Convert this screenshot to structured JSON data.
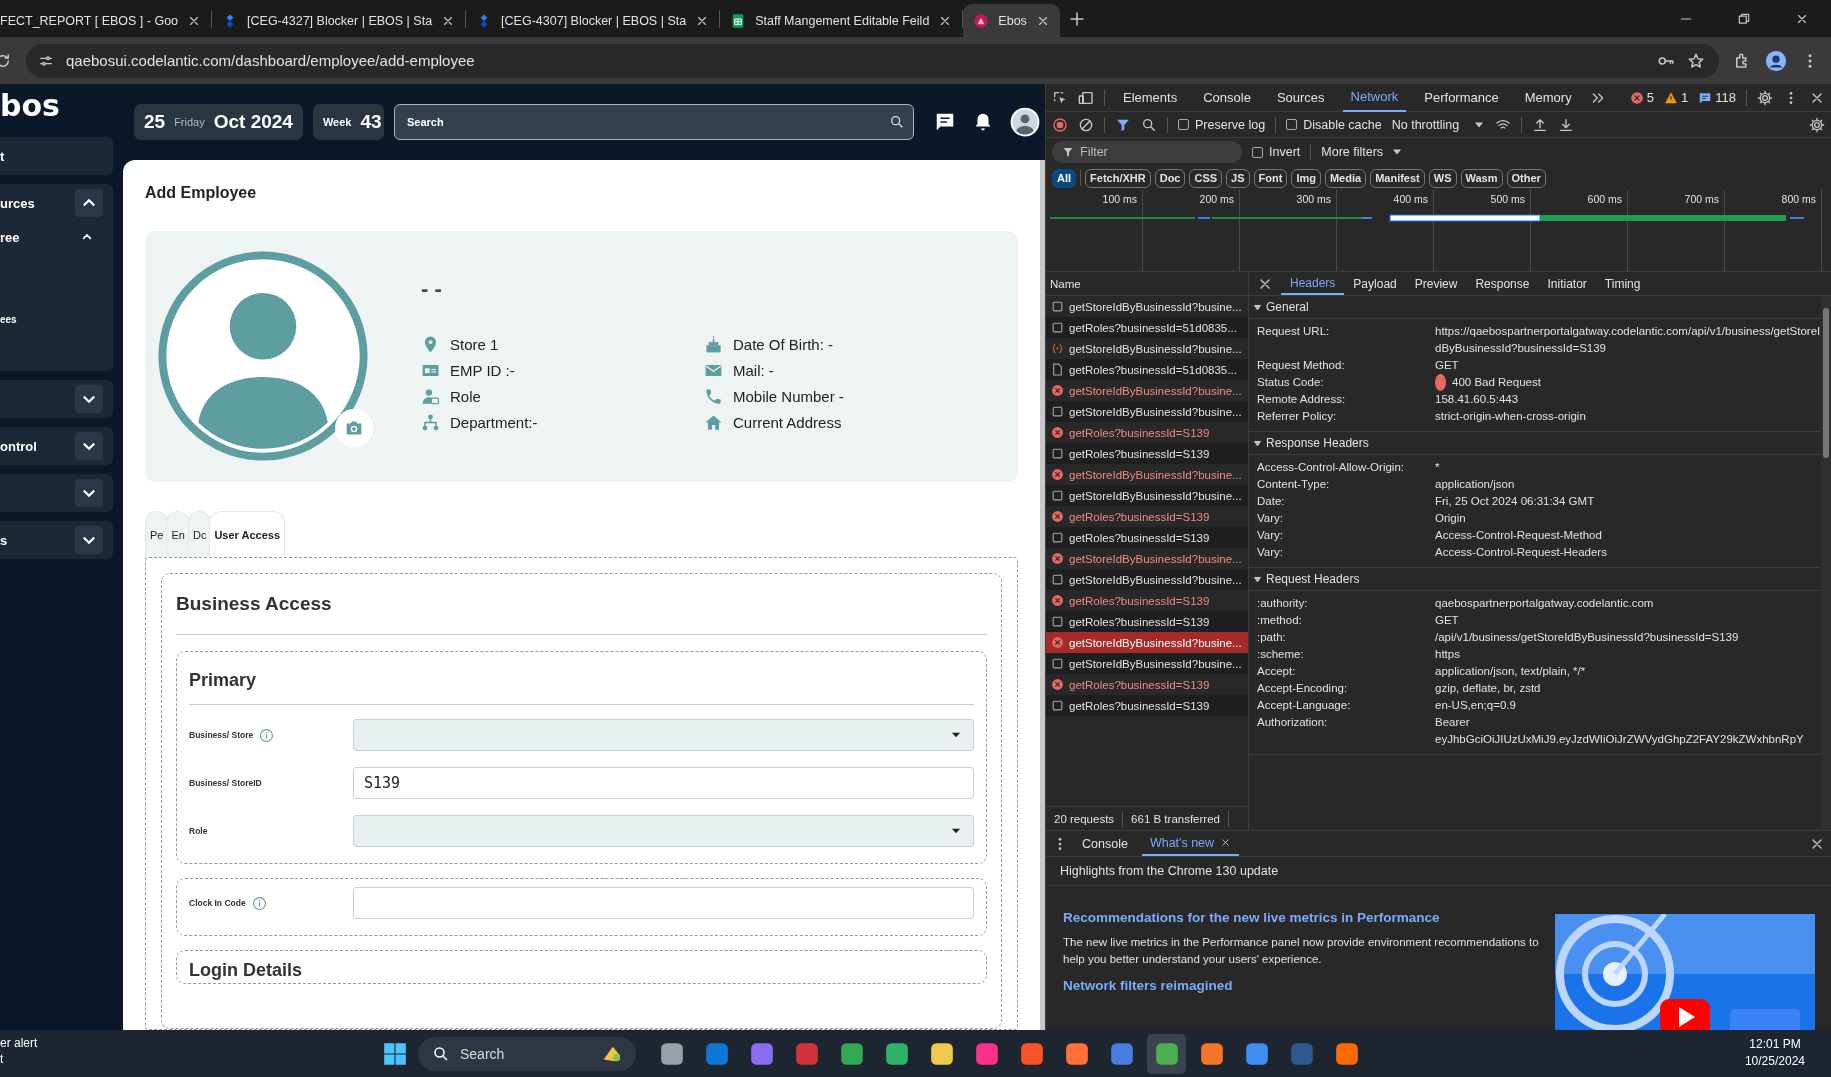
{
  "browser": {
    "tabs": [
      {
        "title": "FECT_REPORT [ EBOS ] - Goo",
        "kind": "plain",
        "selected": false
      },
      {
        "title": "[CEG-4327] Blocker | EBOS | Sta",
        "kind": "issue",
        "selected": false
      },
      {
        "title": "[CEG-4307] Blocker | EBOS | Sta",
        "kind": "issue",
        "selected": false
      },
      {
        "title": "Staff Mangement Editable Feild",
        "kind": "sheet",
        "selected": false
      },
      {
        "title": "Ebos",
        "kind": "app",
        "selected": true
      }
    ],
    "url": "qaebosui.codelantic.com/dashboard/employee/add-employee"
  },
  "sidebar": {
    "logo": "bos",
    "items": [
      {
        "label": "t",
        "kind": "link"
      },
      {
        "label": "urces",
        "kind": "group",
        "expanded": true,
        "children": [
          {
            "label": "ree",
            "kind": "group",
            "expanded": true,
            "children": [
              {
                "label": "ees",
                "kind": "link"
              }
            ]
          }
        ]
      },
      {
        "kind": "group",
        "expanded": false
      },
      {
        "label": "ontrol",
        "kind": "group",
        "expanded": false
      },
      {
        "kind": "group",
        "expanded": false
      },
      {
        "label": "s",
        "kind": "group",
        "expanded": false
      }
    ]
  },
  "header": {
    "date": {
      "day": "25",
      "weekday": "Friday",
      "month_year": "Oct 2024"
    },
    "week": {
      "label": "Week",
      "number": "43"
    },
    "search": {
      "placeholder": "Search"
    }
  },
  "page": {
    "title": "Add Employee",
    "profile": {
      "name": "- -",
      "details": [
        {
          "kind": "location",
          "text": "Store 1"
        },
        {
          "kind": "id-card",
          "text": "EMP ID :-"
        },
        {
          "kind": "person",
          "text": "Role"
        },
        {
          "kind": "org",
          "text": "Department:-"
        },
        {
          "kind": "cake",
          "text": "Date Of Birth: -"
        },
        {
          "kind": "mail",
          "text": "Mail: -"
        },
        {
          "kind": "phone",
          "text": "Mobile Number -"
        },
        {
          "kind": "home",
          "text": "Current Address"
        }
      ]
    },
    "tabs": [
      {
        "label": "Pe",
        "selected": false
      },
      {
        "label": "En",
        "selected": false
      },
      {
        "label": "Dc",
        "selected": false
      },
      {
        "label": "User Access",
        "selected": true
      }
    ],
    "section": {
      "title": "Business Access",
      "groups": [
        {
          "title": "Primary",
          "fields": [
            {
              "label": "Business/ Store",
              "info": true,
              "kind": "select"
            },
            {
              "label": "Business/ StoreID",
              "info": false,
              "kind": "text",
              "value": "S139"
            },
            {
              "label": "Role",
              "info": false,
              "kind": "select"
            }
          ]
        },
        {
          "fields": [
            {
              "label": "Clock In Code",
              "info": true,
              "kind": "text"
            }
          ]
        },
        {
          "title": "Login Details"
        }
      ]
    }
  },
  "devtools": {
    "tabs": [
      {
        "label": "Elements",
        "selected": false
      },
      {
        "label": "Console",
        "selected": false
      },
      {
        "label": "Sources",
        "selected": false
      },
      {
        "label": "Network",
        "selected": true
      },
      {
        "label": "Performance",
        "selected": false
      },
      {
        "label": "Memory",
        "selected": false
      }
    ],
    "errors": "5",
    "warnings": "1",
    "messages": "118",
    "toolbar": {
      "preserve_log": false,
      "preserve_log_label": "Preserve log",
      "disable_cache": false,
      "disable_cache_label": "Disable cache",
      "throttling": "No throttling"
    },
    "filter": {
      "placeholder": "Filter",
      "invert": false,
      "invert_label": "Invert",
      "more_filters": "More filters"
    },
    "types": [
      {
        "label": "All",
        "selected": true
      },
      {
        "label": "Fetch/XHR",
        "selected": false
      },
      {
        "label": "Doc",
        "selected": false
      },
      {
        "label": "CSS",
        "selected": false
      },
      {
        "label": "JS",
        "selected": false
      },
      {
        "label": "Font",
        "selected": false
      },
      {
        "label": "Img",
        "selected": false
      },
      {
        "label": "Media",
        "selected": false
      },
      {
        "label": "Manifest",
        "selected": false
      },
      {
        "label": "WS",
        "selected": false
      },
      {
        "label": "Wasm",
        "selected": false
      },
      {
        "label": "Other",
        "selected": false
      }
    ],
    "timeline_ticks": [
      "100 ms",
      "200 ms",
      "300 ms",
      "400 ms",
      "500 ms",
      "600 ms",
      "700 ms",
      "800 ms"
    ],
    "requests": {
      "column": "Name",
      "rows": [
        {
          "name": "getStoreIdByBusinessId?busine...",
          "kind": "ok",
          "selected": false
        },
        {
          "name": "getRoles?businessId=51d0835...",
          "kind": "ok",
          "selected": false
        },
        {
          "name": "getStoreIdByBusinessId?busine...",
          "kind": "fetch",
          "selected": false
        },
        {
          "name": "getRoles?businessId=51d0835...",
          "kind": "doc",
          "selected": false
        },
        {
          "name": "getStoreIdByBusinessId?busine...",
          "kind": "error",
          "selected": false
        },
        {
          "name": "getStoreIdByBusinessId?busine...",
          "kind": "ok",
          "selected": false
        },
        {
          "name": "getRoles?businessId=S139",
          "kind": "error",
          "selected": false
        },
        {
          "name": "getRoles?businessId=S139",
          "kind": "ok",
          "selected": false
        },
        {
          "name": "getStoreIdByBusinessId?busine...",
          "kind": "error",
          "selected": false
        },
        {
          "name": "getStoreIdByBusinessId?busine...",
          "kind": "ok",
          "selected": false
        },
        {
          "name": "getRoles?businessId=S139",
          "kind": "error",
          "selected": false
        },
        {
          "name": "getRoles?businessId=S139",
          "kind": "ok",
          "selected": false
        },
        {
          "name": "getStoreIdByBusinessId?busine...",
          "kind": "error",
          "selected": false
        },
        {
          "name": "getStoreIdByBusinessId?busine...",
          "kind": "ok",
          "selected": false
        },
        {
          "name": "getRoles?businessId=S139",
          "kind": "error",
          "selected": false
        },
        {
          "name": "getRoles?businessId=S139",
          "kind": "ok",
          "selected": false
        },
        {
          "name": "getStoreIdByBusinessId?busine...",
          "kind": "error",
          "selected": true
        },
        {
          "name": "getStoreIdByBusinessId?busine...",
          "kind": "ok",
          "selected": false
        },
        {
          "name": "getRoles?businessId=S139",
          "kind": "error",
          "selected": false
        },
        {
          "name": "getRoles?businessId=S139",
          "kind": "ok",
          "selected": false
        }
      ],
      "summary": [
        "20 requests",
        "661 B transferred"
      ]
    },
    "detail_tabs": [
      {
        "label": "Headers",
        "selected": true
      },
      {
        "label": "Payload",
        "selected": false
      },
      {
        "label": "Preview",
        "selected": false
      },
      {
        "label": "Response",
        "selected": false
      },
      {
        "label": "Initiator",
        "selected": false
      },
      {
        "label": "Timing",
        "selected": false
      }
    ],
    "sections": [
      {
        "title": "General",
        "expanded": true,
        "rows": [
          {
            "key": "Request URL:",
            "value": "https://qaebospartnerportalgatway.codelantic.com/api/v1/business/getStoreIdByBusinessId?businessId=S139",
            "kind": "plain"
          },
          {
            "key": "Request Method:",
            "value": "GET",
            "kind": "plain"
          },
          {
            "key": "Status Code:",
            "value": "400 Bad Request",
            "kind": "status"
          },
          {
            "key": "Remote Address:",
            "value": "158.41.60.5:443",
            "kind": "plain"
          },
          {
            "key": "Referrer Policy:",
            "value": "strict-origin-when-cross-origin",
            "kind": "plain"
          }
        ]
      },
      {
        "title": "Response Headers",
        "expanded": true,
        "rows": [
          {
            "key": "Access-Control-Allow-Origin:",
            "value": "*"
          },
          {
            "key": "Content-Type:",
            "value": "application/json"
          },
          {
            "key": "Date:",
            "value": "Fri, 25 Oct 2024 06:31:34 GMT"
          },
          {
            "key": "Vary:",
            "value": "Origin"
          },
          {
            "key": "Vary:",
            "value": "Access-Control-Request-Method"
          },
          {
            "key": "Vary:",
            "value": "Access-Control-Request-Headers"
          }
        ]
      },
      {
        "title": "Request Headers",
        "expanded": true,
        "rows": [
          {
            "key": ":authority:",
            "value": "qaebospartnerportalgatway.codelantic.com"
          },
          {
            "key": ":method:",
            "value": "GET"
          },
          {
            "key": ":path:",
            "value": "/api/v1/business/getStoreIdByBusinessId?businessId=S139"
          },
          {
            "key": ":scheme:",
            "value": "https"
          },
          {
            "key": "Accept:",
            "value": "application/json, text/plain, */*"
          },
          {
            "key": "Accept-Encoding:",
            "value": "gzip, deflate, br, zstd"
          },
          {
            "key": "Accept-Language:",
            "value": "en-US,en;q=0.9"
          },
          {
            "key": "Authorization:",
            "value": "Bearer"
          },
          {
            "value": "eyJhbGciOiJIUzUxMiJ9.eyJzdWIiOiJrZWVydGhpZ2FAY29kZWxhbnRpY"
          }
        ]
      }
    ]
  },
  "drawer": {
    "tabs": [
      {
        "label": "Console",
        "selected": false
      },
      {
        "label": "What's new",
        "selected": true
      }
    ],
    "heading": "Highlights from the Chrome 130 update",
    "articles": [
      {
        "title": "Recommendations for the new live metrics in Performance",
        "text": "The new live metrics in the Performance panel now provide environment recommendations to help you better understand your users' experience."
      },
      {
        "title": "Network filters reimagined"
      }
    ]
  },
  "taskbar": {
    "notification": [
      "er alert",
      "t"
    ],
    "search": {
      "placeholder": "Search"
    },
    "apps": [
      {
        "color": "#9aa0a6",
        "selected": false
      },
      {
        "color": "#0f78d4",
        "selected": false
      },
      {
        "color": "#8a6cf0",
        "selected": false
      },
      {
        "color": "#d13438",
        "selected": false
      },
      {
        "color": "#34a853",
        "selected": false
      },
      {
        "color": "#2fb36b",
        "selected": false
      },
      {
        "color": "#f2c94c",
        "selected": false
      },
      {
        "color": "#fc318c",
        "selected": false
      },
      {
        "color": "#fb542b",
        "selected": false
      },
      {
        "color": "#ff7139",
        "selected": false
      },
      {
        "color": "#4a7de0",
        "selected": false
      },
      {
        "color": "#4caf50",
        "selected": true
      },
      {
        "color": "#f7752a",
        "selected": false
      },
      {
        "color": "#3f8ef0",
        "selected": false
      },
      {
        "color": "#2d5a8c",
        "selected": false
      },
      {
        "color": "#ff6a00",
        "selected": false
      }
    ],
    "time": "12:01 PM",
    "date": "10/25/2024"
  }
}
